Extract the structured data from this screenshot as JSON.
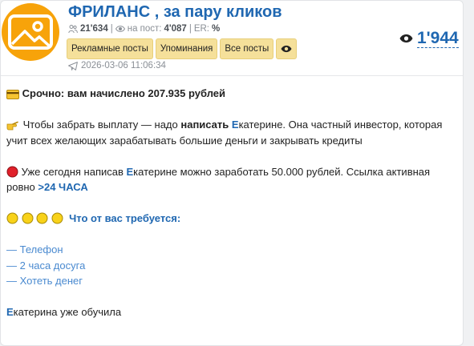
{
  "channel": {
    "title": "ФРИЛАНС , за пару кликов",
    "subscribers": "21'634",
    "per_post_label": "на пост:",
    "per_post": "4'087",
    "er_label": "ER:",
    "er_value": "%",
    "views": "1'944",
    "date": "2026-03-06 11:06:34",
    "accent": "#1f67b1"
  },
  "buttons": {
    "ads": "Рекламные посты",
    "mentions": "Упоминания",
    "all": "Все посты"
  },
  "post": {
    "line1": "Срочно: вам начислено 207.935 рублей",
    "line2_a": "Чтобы забрать выплату — надо ",
    "line2_b": "написать",
    "line2_c": " ",
    "line2_d": "Е",
    "line2_e": "катерине. Она частный инвестор, которая учит всех желающих зарабатывать большие деньги и закрывать кредиты",
    "line3_a": "Уже сегодня написав ",
    "line3_b": "Е",
    "line3_c": "катерине можно заработать 50.000 рублей. Ссылка активная ровно ",
    "line3_d": ">24 ЧАСА",
    "line4": "Что от вас требуется:",
    "list": [
      "— Телефон",
      "— 2 часа досуга",
      "— Хотеть денег"
    ],
    "line5_a": "Е",
    "line5_b": "катерина уже обучила"
  },
  "icons": {
    "avatar": "mountain-sun-icon",
    "subscribers": "people-icon",
    "views": "eye-icon",
    "date": "telegram-plane-icon",
    "card": "credit-card-emoji",
    "pointing": "pointing-hand-emoji",
    "red": "red-circle-emoji",
    "yellow": "yellow-circle-emoji"
  }
}
